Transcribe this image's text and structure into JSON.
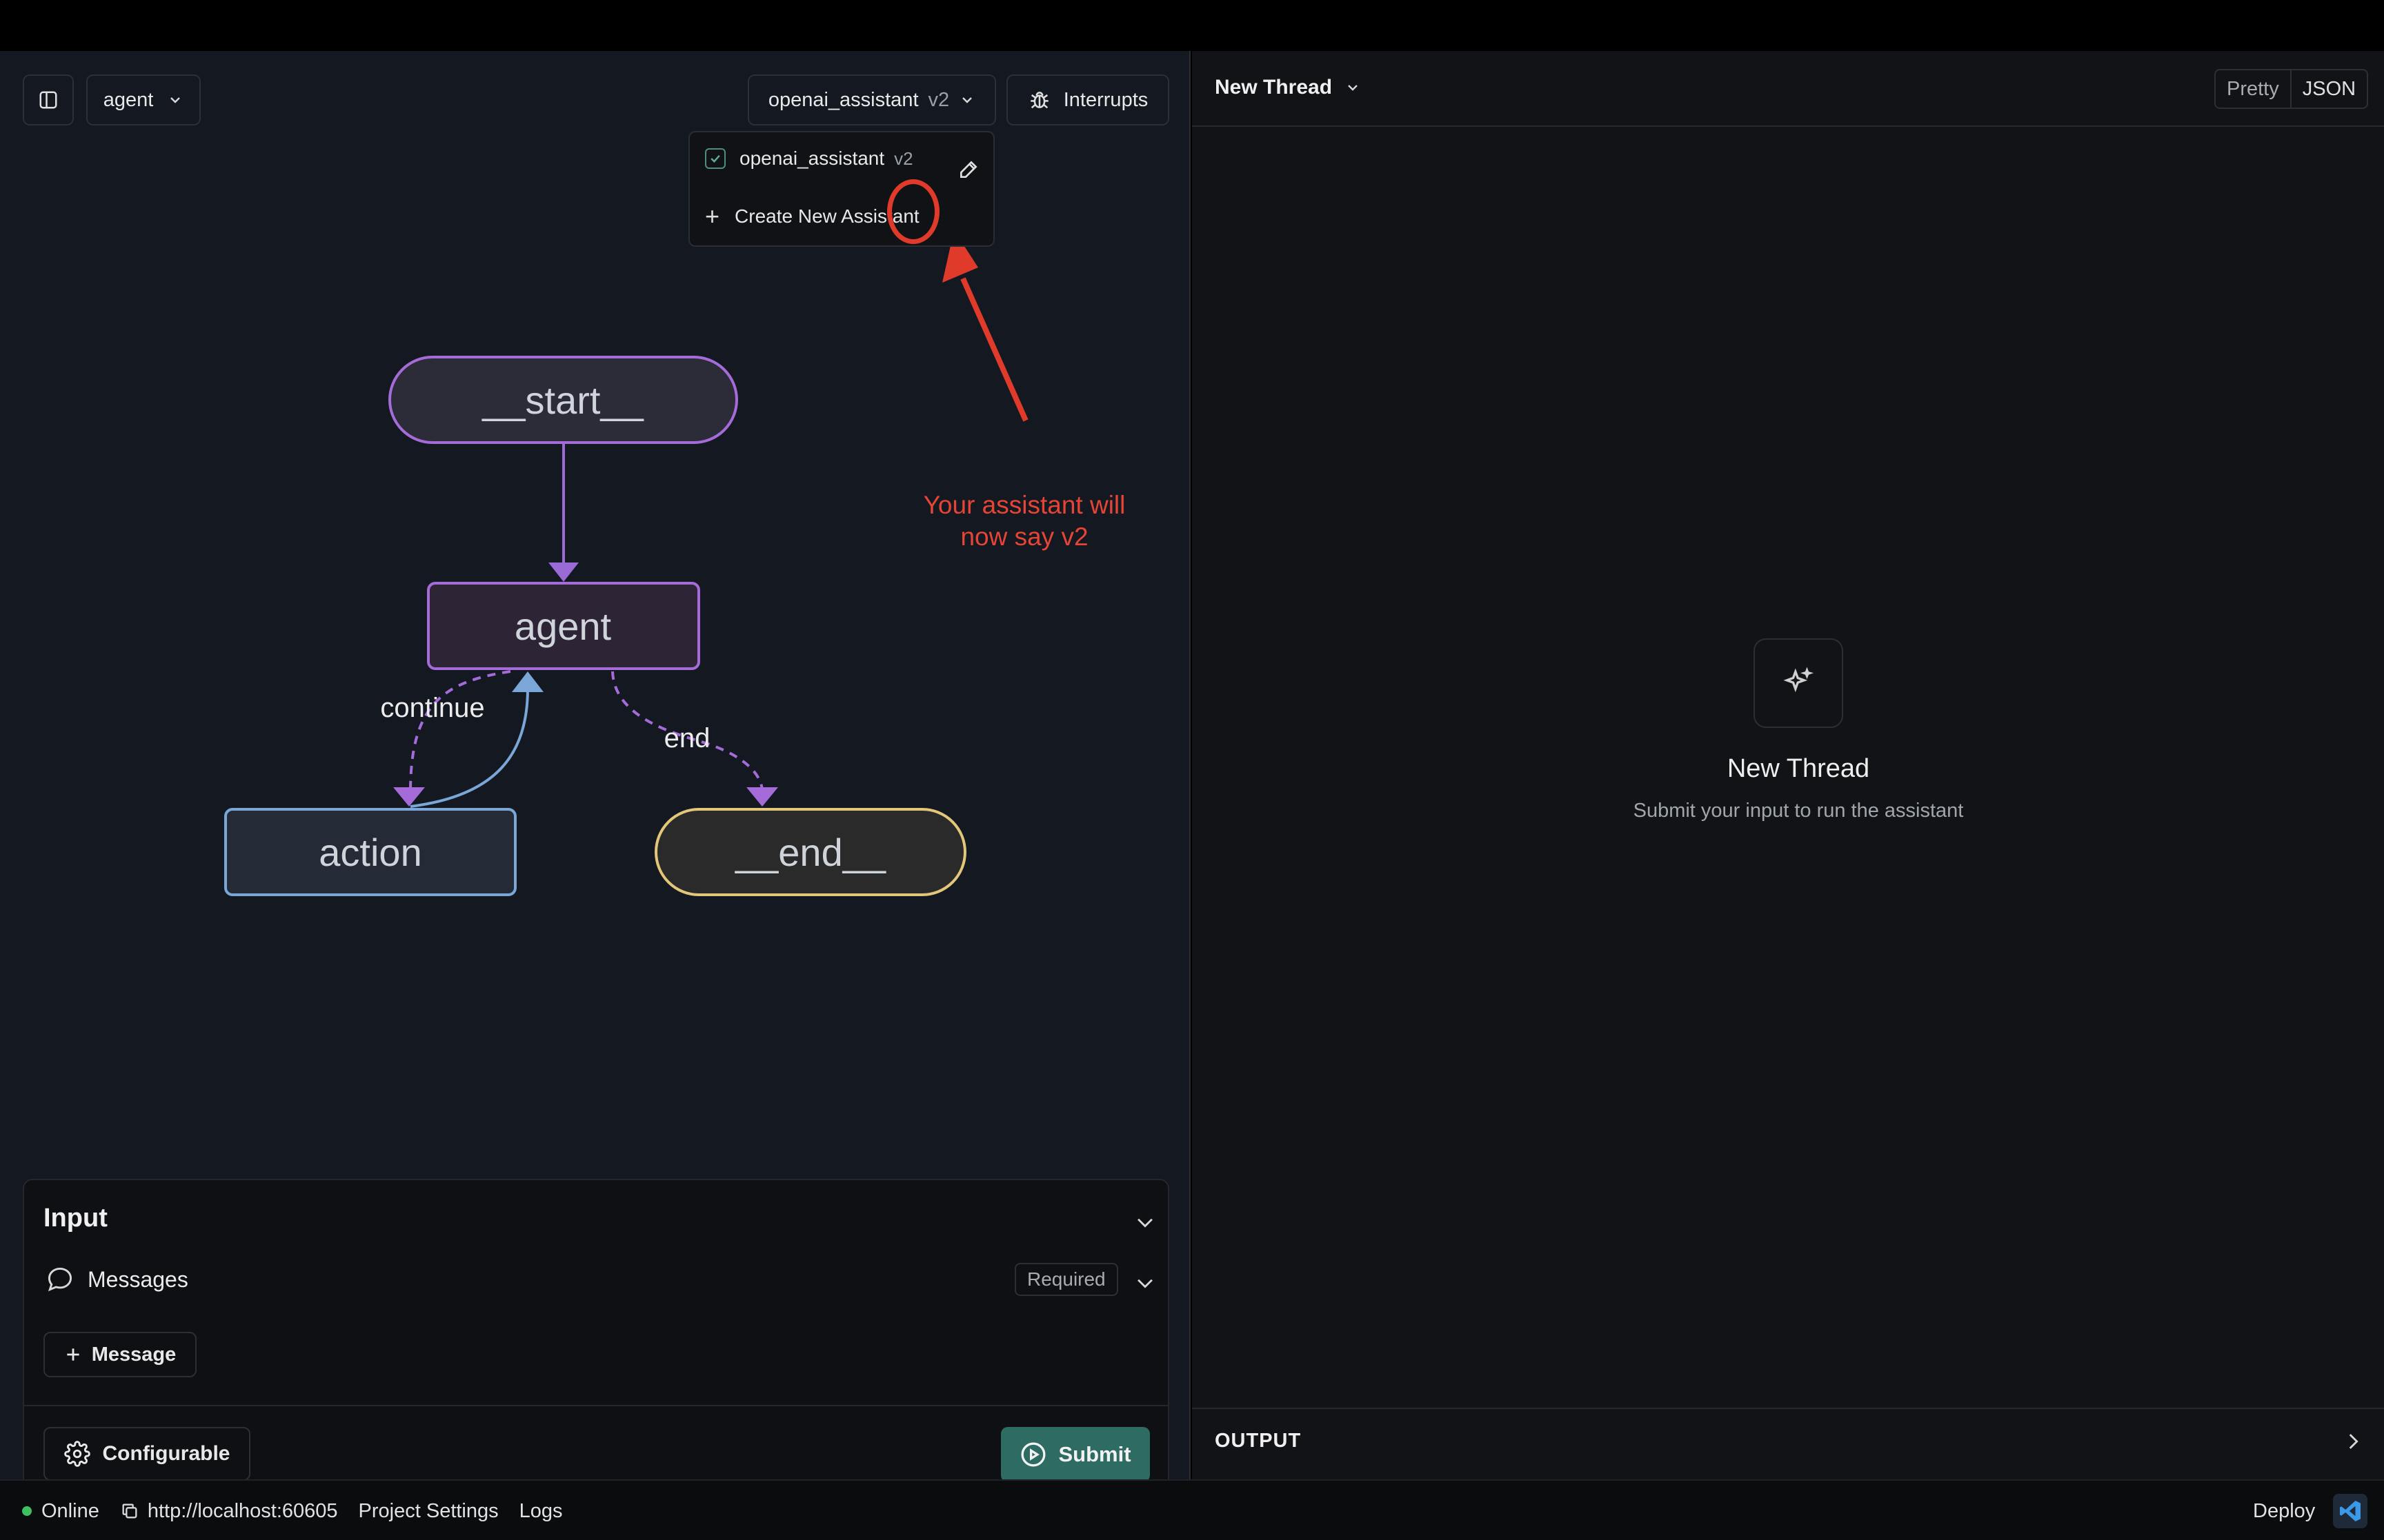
{
  "header": {
    "graph_selector": "agent",
    "assistant_selector": {
      "name": "openai_assistant",
      "version": "v2"
    },
    "interrupts_label": "Interrupts"
  },
  "assistant_dropdown": {
    "items": [
      {
        "name": "openai_assistant",
        "version": "v2",
        "checked": true
      },
      {
        "label": "Create New Assistant"
      }
    ]
  },
  "annotation": {
    "text_line1": "Your assistant will",
    "text_line2": "now say v2",
    "color": "#e03a2a"
  },
  "graph": {
    "nodes": [
      {
        "id": "start",
        "label": "__start__",
        "color": "#a46bd9"
      },
      {
        "id": "agent",
        "label": "agent",
        "color": "#a46bd9"
      },
      {
        "id": "action",
        "label": "action",
        "color": "#7aa6d8"
      },
      {
        "id": "end",
        "label": "__end__",
        "color": "#e3c779"
      }
    ],
    "edges": [
      {
        "from": "start",
        "to": "agent",
        "label": ""
      },
      {
        "from": "agent",
        "to": "action",
        "label": "continue"
      },
      {
        "from": "action",
        "to": "agent",
        "label": ""
      },
      {
        "from": "agent",
        "to": "end",
        "label": "end"
      }
    ]
  },
  "input_panel": {
    "title": "Input",
    "messages_label": "Messages",
    "required_label": "Required",
    "add_message_label": "Message",
    "configurable_label": "Configurable",
    "submit_label": "Submit"
  },
  "thread_panel": {
    "title": "New Thread",
    "view_modes": [
      "Pretty",
      "JSON"
    ],
    "empty_title": "New Thread",
    "empty_subtitle": "Submit your input to run the assistant",
    "output_label": "OUTPUT"
  },
  "status_bar": {
    "status": "Online",
    "url": "http://localhost:60605",
    "project_settings": "Project Settings",
    "logs": "Logs",
    "deploy": "Deploy"
  },
  "colors": {
    "accent_submit": "#2e6b62",
    "status_online": "#3fbf5f"
  }
}
